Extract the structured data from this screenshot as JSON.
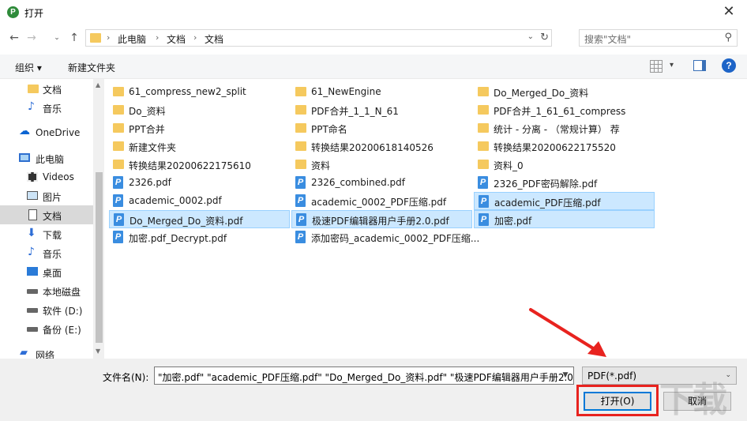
{
  "window": {
    "title": "打开"
  },
  "address": {
    "crumbs": [
      "此电脑",
      "文档",
      "文档"
    ],
    "search_placeholder": "搜索\"文档\""
  },
  "toolbar": {
    "organize": "组织 ▾",
    "new_folder": "新建文件夹"
  },
  "nav": {
    "items": [
      {
        "label": "文档",
        "icon": "folder-icon"
      },
      {
        "label": "音乐",
        "icon": "music-icon"
      },
      {
        "label": "OneDrive",
        "icon": "cloud-icon"
      },
      {
        "label": "此电脑",
        "icon": "computer-icon"
      },
      {
        "label": "Videos",
        "icon": "video-icon"
      },
      {
        "label": "图片",
        "icon": "picture-icon"
      },
      {
        "label": "文档",
        "icon": "document-icon"
      },
      {
        "label": "下载",
        "icon": "download-icon"
      },
      {
        "label": "音乐",
        "icon": "music-icon"
      },
      {
        "label": "桌面",
        "icon": "desktop-icon"
      },
      {
        "label": "本地磁盘",
        "icon": "drive-icon"
      },
      {
        "label": "软件 (D:)",
        "icon": "drive-icon"
      },
      {
        "label": "备份 (E:)",
        "icon": "drive-icon"
      },
      {
        "label": "网络",
        "icon": "network-icon"
      }
    ]
  },
  "files": {
    "col1": [
      {
        "name": "61_compress_new2_split",
        "type": "folder"
      },
      {
        "name": "Do_资料",
        "type": "folder"
      },
      {
        "name": "PPT合并",
        "type": "folder"
      },
      {
        "name": "新建文件夹",
        "type": "folder"
      },
      {
        "name": "转换结果20200622175610",
        "type": "folder"
      },
      {
        "name": "2326.pdf",
        "type": "pdf"
      },
      {
        "name": "academic_0002.pdf",
        "type": "pdf"
      },
      {
        "name": "Do_Merged_Do_资料.pdf",
        "type": "pdf",
        "selected": true
      },
      {
        "name": "加密.pdf_Decrypt.pdf",
        "type": "pdf"
      }
    ],
    "col2": [
      {
        "name": "61_NewEngine",
        "type": "folder"
      },
      {
        "name": "PDF合并_1_1_N_61",
        "type": "folder"
      },
      {
        "name": "PPT命名",
        "type": "folder"
      },
      {
        "name": "转换结果20200618140526",
        "type": "folder"
      },
      {
        "name": "资料",
        "type": "folder"
      },
      {
        "name": "2326_combined.pdf",
        "type": "pdf"
      },
      {
        "name": "academic_0002_PDF压缩.pdf",
        "type": "pdf"
      },
      {
        "name": "极速PDF编辑器用户手册2.0.pdf",
        "type": "pdf",
        "selected": true
      },
      {
        "name": "添加密码_academic_0002_PDF压缩...",
        "type": "pdf"
      }
    ],
    "col3": [
      {
        "name": "Do_Merged_Do_资料",
        "type": "folder"
      },
      {
        "name": "PDF合并_1_61_61_compress",
        "type": "folder"
      },
      {
        "name": "统计 - 分离 - （常规计算） 荐",
        "type": "folder"
      },
      {
        "name": "转换结果20200622175520",
        "type": "folder"
      },
      {
        "name": "资料_0",
        "type": "folder"
      },
      {
        "name": "2326_PDF密码解除.pdf",
        "type": "pdf"
      },
      {
        "name": "academic_PDF压缩.pdf",
        "type": "pdf",
        "selected": true
      },
      {
        "name": "加密.pdf",
        "type": "pdf",
        "selected": true
      }
    ]
  },
  "bottom": {
    "filename_label": "文件名(N):",
    "filename_value": "\"加密.pdf\" \"academic_PDF压缩.pdf\" \"Do_Merged_Do_资料.pdf\" \"极速PDF编辑器用户手册2.0",
    "filetype": "PDF(*.pdf)",
    "open_label": "打开(O)",
    "cancel_label": "取消"
  },
  "colors": {
    "accent": "#0078d7",
    "highlight": "#e8231f",
    "selection": "#cce8ff"
  }
}
